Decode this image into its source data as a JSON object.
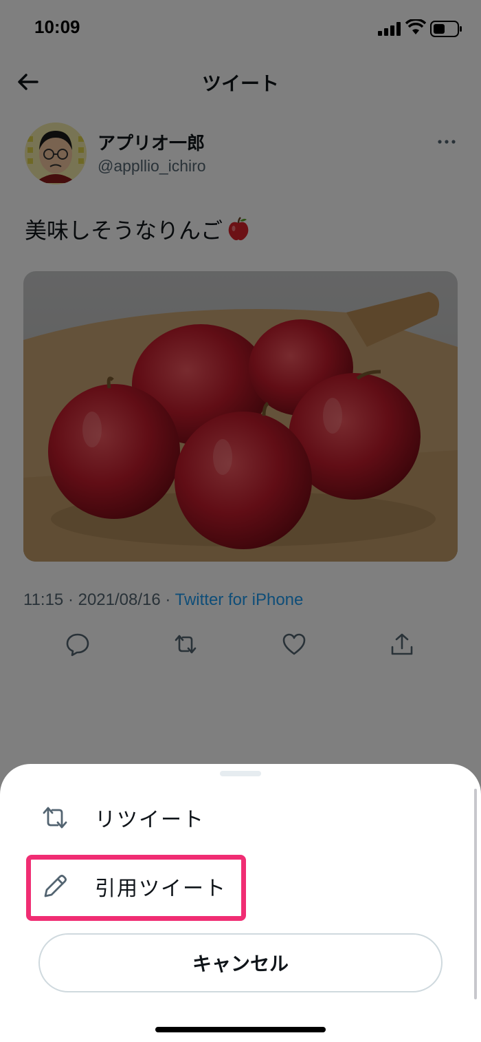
{
  "status_bar": {
    "time": "10:09"
  },
  "header": {
    "title": "ツイート"
  },
  "tweet": {
    "author_name": "アプリオ一郎",
    "author_handle": "@appllio_ichiro",
    "text": "美味しそうなりんご",
    "timestamp": "11:15 · 2021/08/16 · ",
    "source": "Twitter for iPhone"
  },
  "sheet": {
    "retweet_label": "リツイート",
    "quote_label": "引用ツイート",
    "cancel_label": "キャンセル"
  },
  "colors": {
    "accent": "#1d9bf0",
    "highlight": "#f02d73",
    "text": "#0f1419",
    "secondary_text": "#536471"
  },
  "icons": [
    "back-arrow-icon",
    "more-icon",
    "reply-icon",
    "retweet-icon",
    "like-icon",
    "share-icon",
    "pencil-icon"
  ]
}
